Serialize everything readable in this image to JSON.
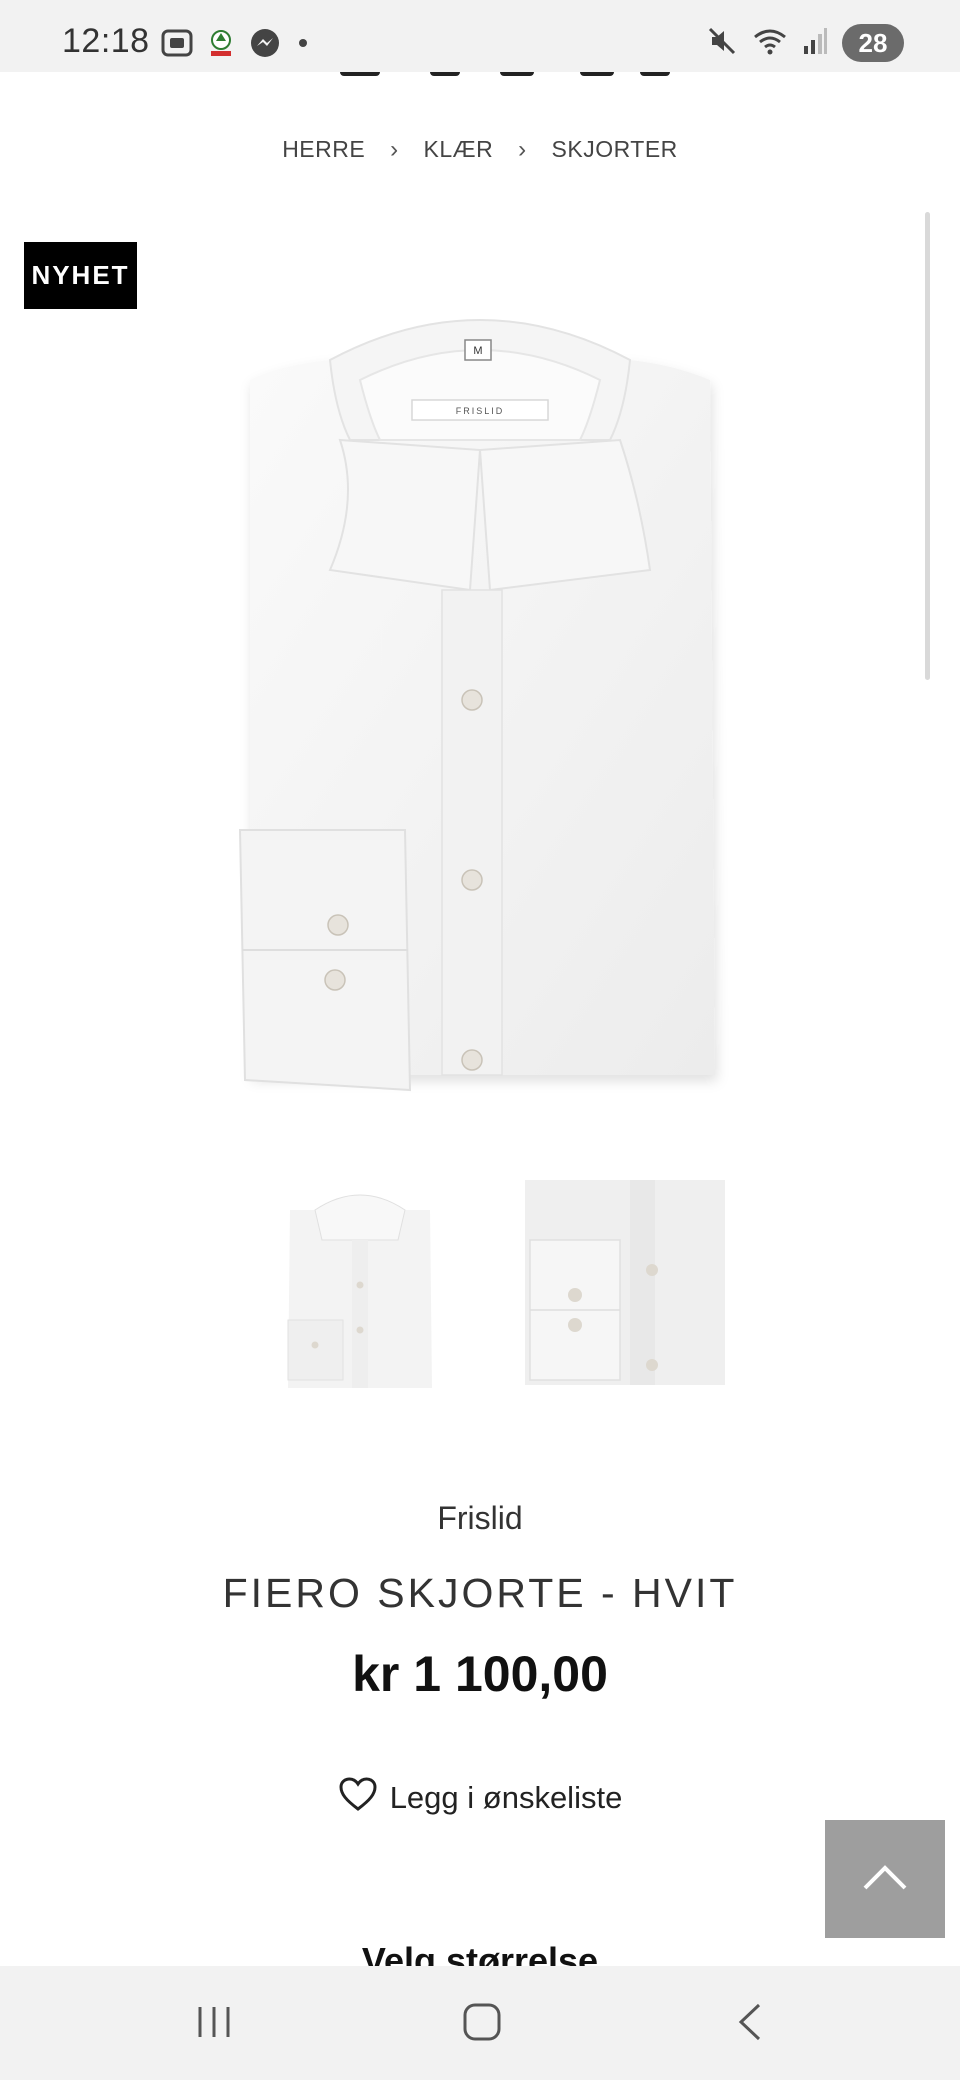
{
  "status_bar": {
    "time": "12:18",
    "left_icons": [
      "screenshot-icon",
      "store-icon",
      "messenger-icon",
      "dot-icon"
    ],
    "right_icons": [
      "mute-icon",
      "wifi-icon",
      "signal-icon"
    ],
    "battery": "28"
  },
  "breadcrumb": [
    "HERRE",
    "KLÆR",
    "SKJORTER"
  ],
  "badge": "NYHET",
  "product": {
    "brand": "Frislid",
    "title": "FIERO SKJORTE - HVIT",
    "price": "kr 1 100,00",
    "collar_label": "FRISLID",
    "size_tag": "M"
  },
  "wishlist_label": "Legg i ønskeliste",
  "size_heading": "Velg størrelse",
  "navigation": [
    "recent-apps-icon",
    "home-icon",
    "back-icon"
  ]
}
